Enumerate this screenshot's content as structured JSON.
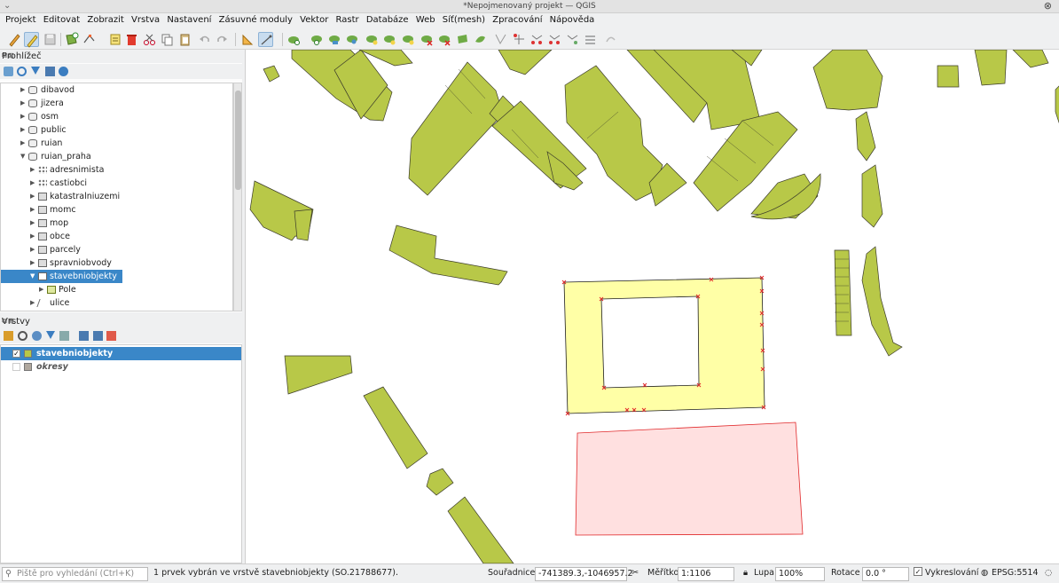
{
  "window": {
    "title": "*Nepojmenovaný projekt — QGIS"
  },
  "menu": [
    "Projekt",
    "Editovat",
    "Zobrazit",
    "Vrstva",
    "Nastavení",
    "Zásuvné moduly",
    "Vektor",
    "Rastr",
    "Databáze",
    "Web",
    "Síť(mesh)",
    "Zpracování",
    "Nápověda"
  ],
  "browser": {
    "title": "Prohlížeč",
    "items": [
      {
        "label": "dibavod",
        "icon": "database-icon"
      },
      {
        "label": "jizera",
        "icon": "database-icon"
      },
      {
        "label": "osm",
        "icon": "database-icon"
      },
      {
        "label": "public",
        "icon": "database-icon"
      },
      {
        "label": "ruian",
        "icon": "database-icon"
      },
      {
        "label": "ruian_praha",
        "icon": "database-icon"
      },
      {
        "label": "adresnimista",
        "icon": "point-layer-icon"
      },
      {
        "label": "castiobci",
        "icon": "point-layer-icon"
      },
      {
        "label": "katastralniuzemi",
        "icon": "polygon-layer-icon"
      },
      {
        "label": "momc",
        "icon": "polygon-layer-icon"
      },
      {
        "label": "mop",
        "icon": "polygon-layer-icon"
      },
      {
        "label": "obce",
        "icon": "polygon-layer-icon"
      },
      {
        "label": "parcely",
        "icon": "polygon-layer-icon"
      },
      {
        "label": "spravniobvody",
        "icon": "polygon-layer-icon"
      },
      {
        "label": "stavebniobjekty",
        "icon": "polygon-layer-icon"
      },
      {
        "label": "Pole",
        "icon": "table-icon"
      },
      {
        "label": "ulice",
        "icon": "line-layer-icon"
      }
    ]
  },
  "layers_panel": {
    "title": "Vrstvy",
    "items": [
      {
        "label": "stavebniobjekty",
        "checked": true,
        "color": "#b8c848"
      },
      {
        "label": "okresy",
        "checked": false,
        "color": "#b0a89e"
      }
    ]
  },
  "status": {
    "search_placeholder": "Piště pro vyhledání (Ctrl+K)",
    "message": "1 prvek vybrán ve vrstvě stavebniobjekty (SO.21788677).",
    "coord_label": "Souřadnice",
    "coord_value": "-741389.3,-1046957.2",
    "scale_label": "Měřítko",
    "scale_value": "1:1106",
    "magnifier_label": "Lupa",
    "magnifier_value": "100%",
    "rotation_label": "Rotace",
    "rotation_value": "0.0 °",
    "render_label": "Vykreslování",
    "crs": "EPSG:5514"
  },
  "colors": {
    "building": "#b8c848",
    "selected": "#ffffa6",
    "selection_edge": "#e0282a",
    "other_fill": "#ffe0e0",
    "highlight": "#3a87c8"
  }
}
